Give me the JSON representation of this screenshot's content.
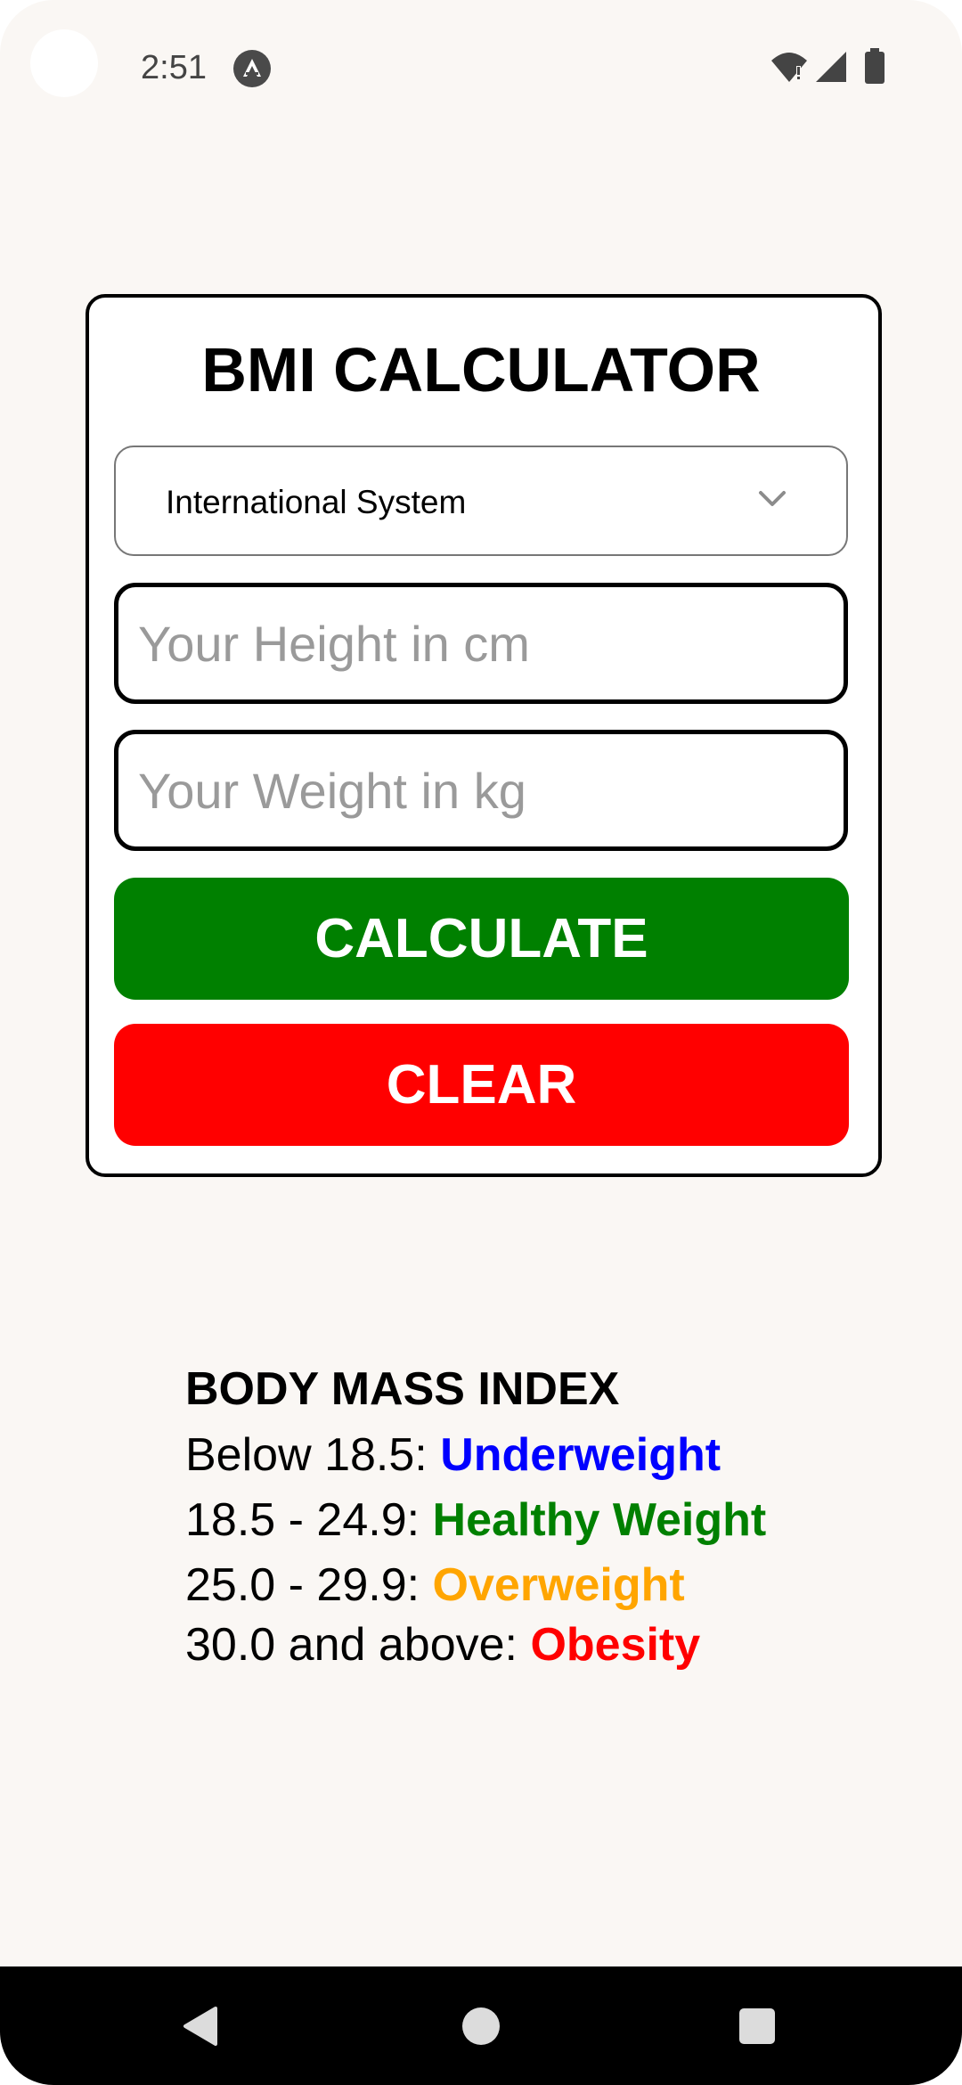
{
  "status_bar": {
    "time": "2:51",
    "app_icon": "expo-icon",
    "right_icons": [
      "wifi-alert-icon",
      "cellular-signal-icon",
      "battery-icon"
    ]
  },
  "calculator": {
    "title": "BMI CALCULATOR",
    "unit_system": {
      "selected": "International System",
      "icon": "chevron-down-icon"
    },
    "height_field": {
      "value": "",
      "placeholder": "Your Height in cm"
    },
    "weight_field": {
      "value": "",
      "placeholder": "Your Weight in kg"
    },
    "calculate_label": "CALCULATE",
    "clear_label": "CLEAR"
  },
  "bmi_legend": {
    "title": "BODY MASS INDEX",
    "rows": [
      {
        "range": "Below 18.5: ",
        "category": "Underweight"
      },
      {
        "range": "18.5 - 24.9: ",
        "category": "Healthy Weight"
      },
      {
        "range": "25.0 - 29.9: ",
        "category": "Overweight"
      },
      {
        "range": "30.0 and above: ",
        "category": "Obesity"
      }
    ]
  },
  "colors": {
    "background": "#faf7f4",
    "calculate": "#008000",
    "clear": "#ff0000",
    "underweight": "#0000ff",
    "healthy": "#008000",
    "overweight": "#ffa500",
    "obesity": "#ff0000"
  },
  "nav_bar": {
    "icons": [
      "back-icon",
      "home-icon",
      "recents-icon"
    ]
  }
}
